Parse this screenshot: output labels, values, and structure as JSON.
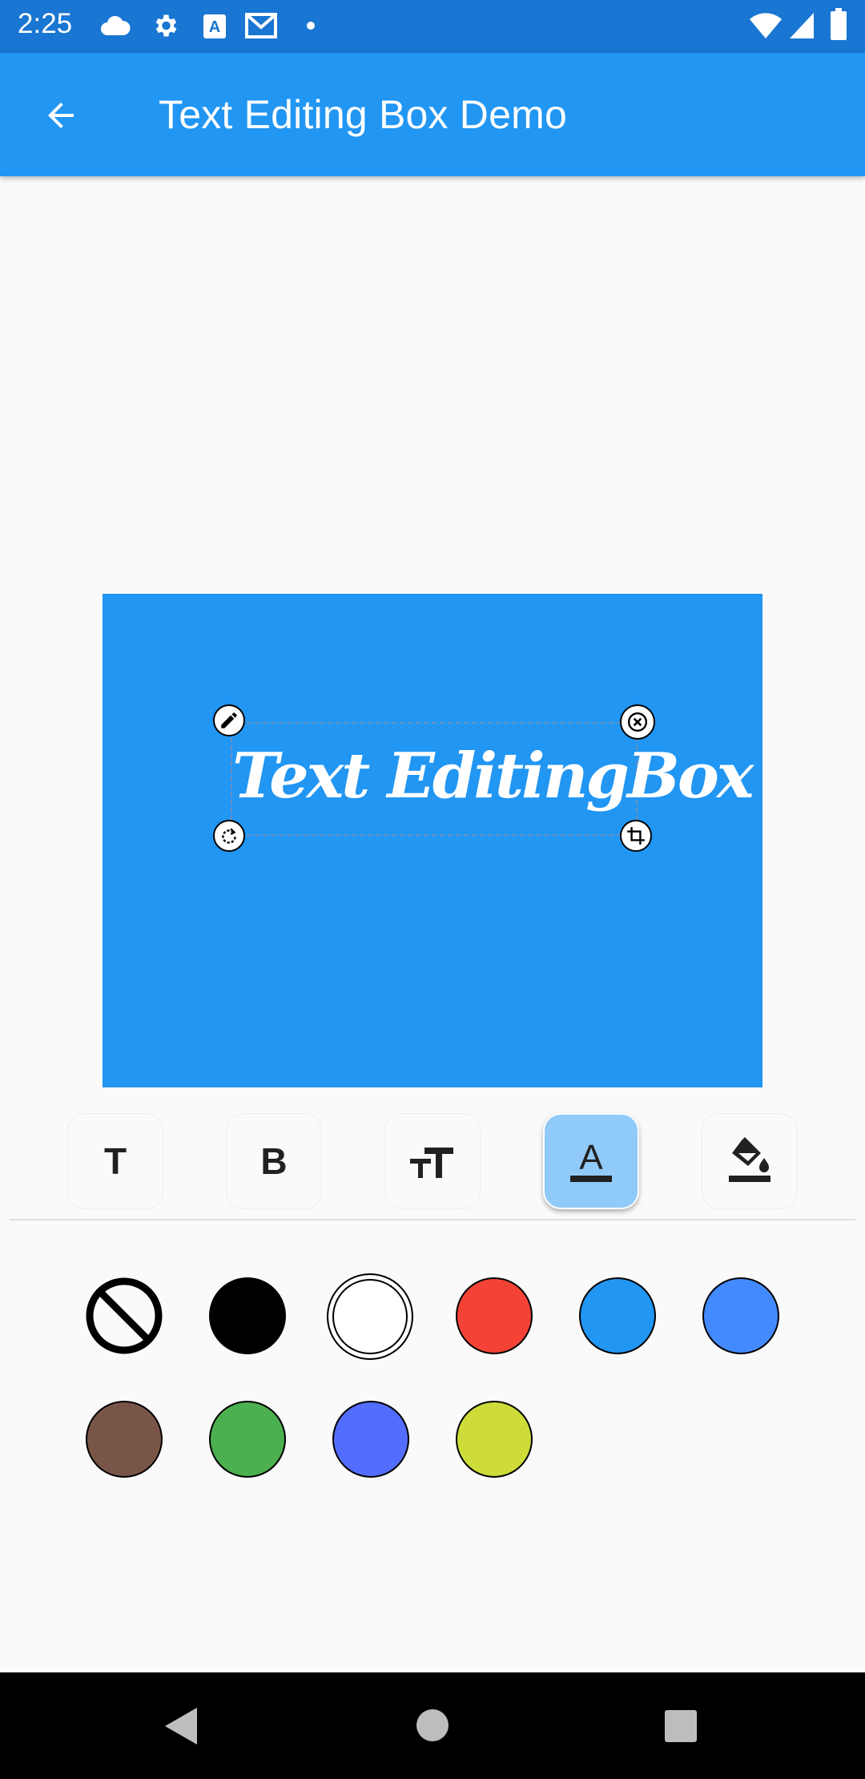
{
  "status_bar": {
    "time": "2:25",
    "icons": [
      "cloud-icon",
      "gear-icon",
      "a-badge-icon",
      "gmail-icon",
      "dot-icon",
      "wifi-icon",
      "signal-icon",
      "battery-icon"
    ]
  },
  "app_bar": {
    "title": "Text Editing Box Demo",
    "back_icon": "arrow-back-icon"
  },
  "canvas": {
    "background": "#2196f3",
    "text": "Text EditingBox",
    "handles": [
      "edit-icon",
      "close-icon",
      "rotate-icon",
      "crop-icon"
    ]
  },
  "toolbar": {
    "tools": [
      {
        "name": "text",
        "label": "T"
      },
      {
        "name": "bold",
        "label": "B"
      },
      {
        "name": "font-size",
        "label": "TT"
      },
      {
        "name": "text-color",
        "label": "A",
        "active": true
      },
      {
        "name": "background-color",
        "label": ""
      }
    ]
  },
  "colors": {
    "options": [
      "none",
      "#000000",
      "#ffffff",
      "#f44336",
      "#2196f3",
      "#448aff",
      "#795548",
      "#4caf50",
      "#536dfe",
      "#cddc39"
    ],
    "selected": "#ffffff"
  },
  "accent": "#2196f3"
}
